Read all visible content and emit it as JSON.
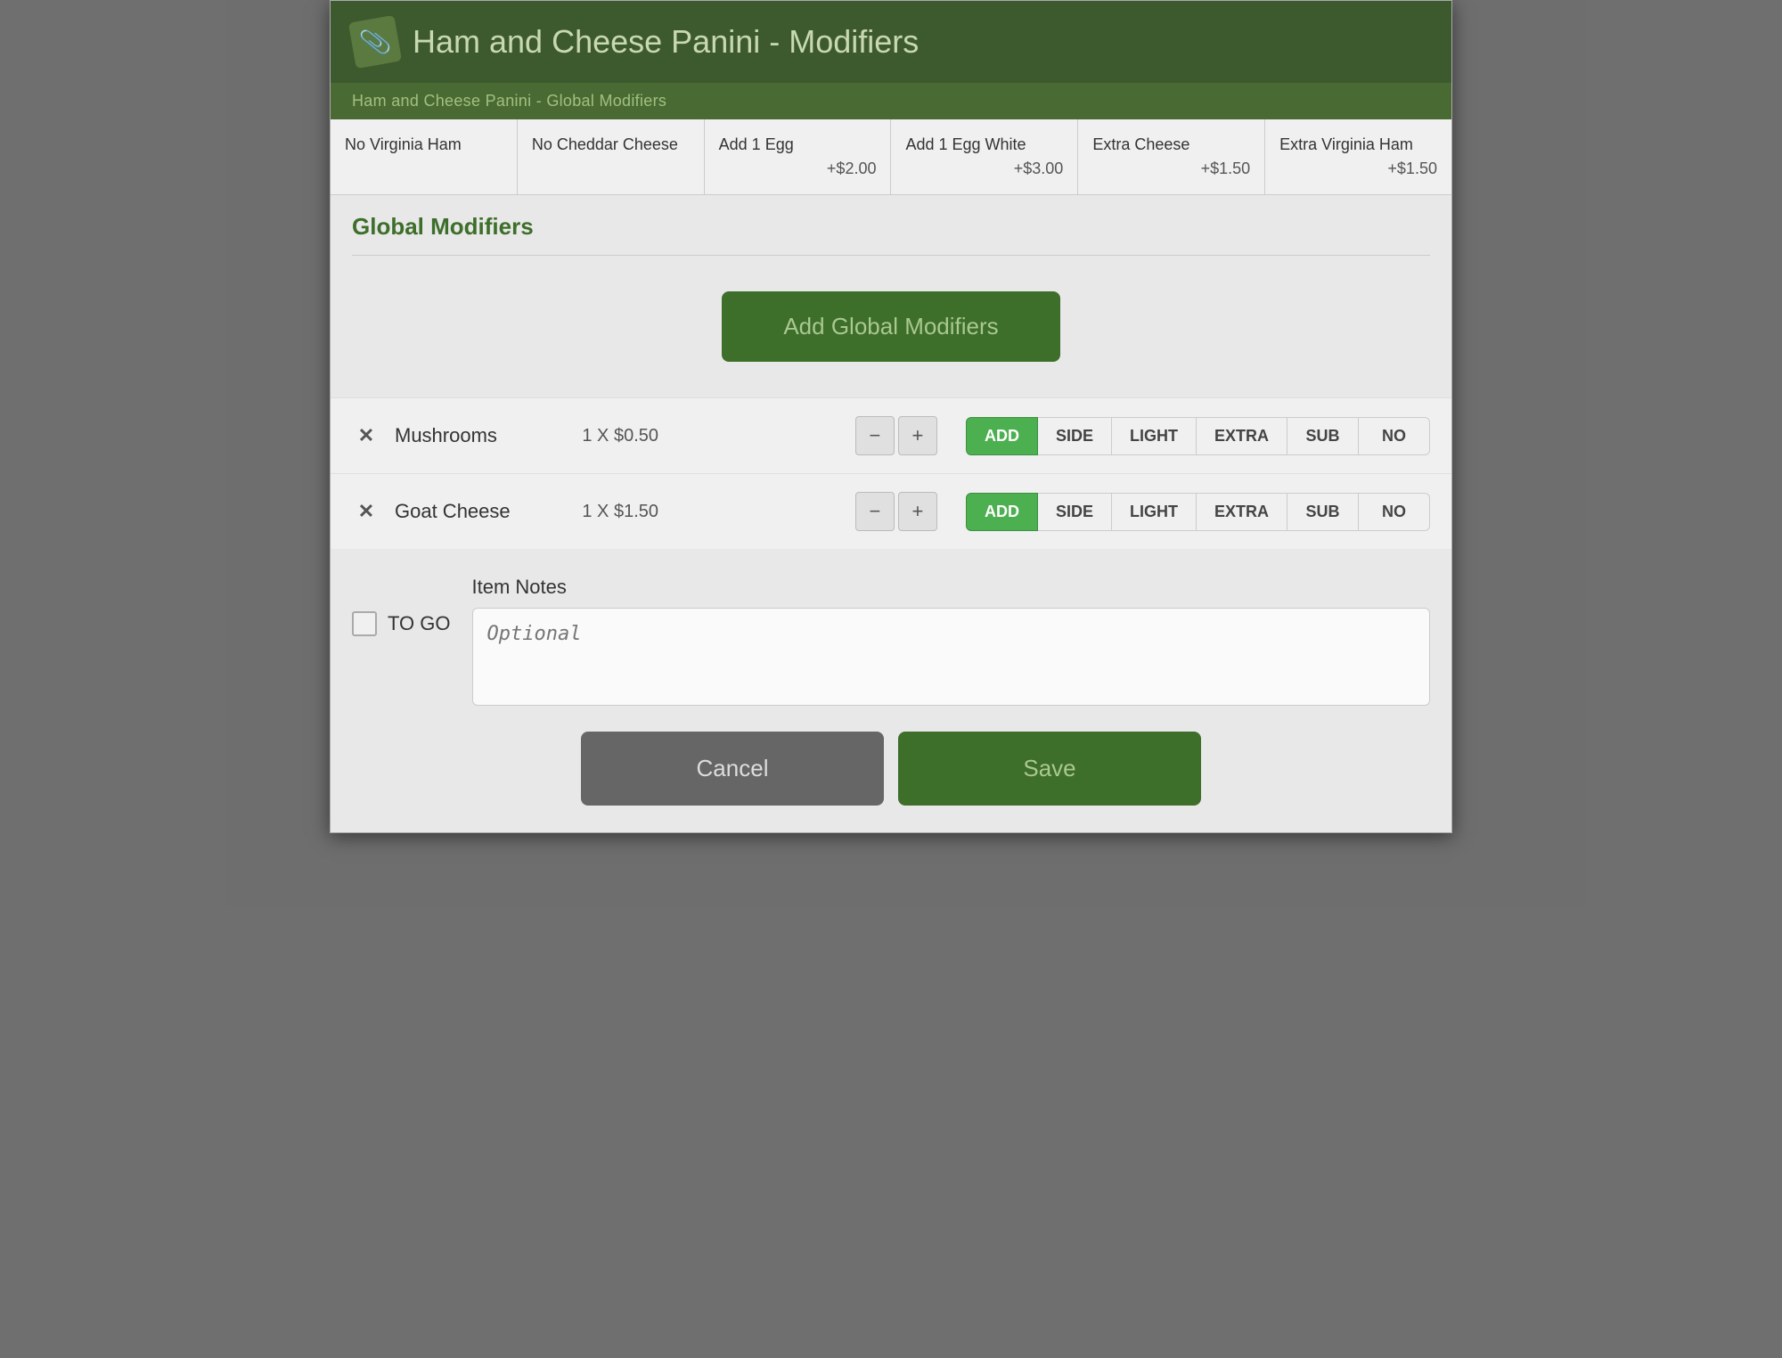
{
  "header": {
    "title": "Ham and Cheese Panini - Modifiers",
    "subtitle": "Ham and Cheese Panini - Global Modifiers",
    "icon": "📎"
  },
  "chips": [
    {
      "name": "No Virginia Ham",
      "price": ""
    },
    {
      "name": "No Cheddar Cheese",
      "price": ""
    },
    {
      "name": "Add 1 Egg",
      "price": "+$2.00"
    },
    {
      "name": "Add 1 Egg White",
      "price": "+$3.00"
    },
    {
      "name": "Extra Cheese",
      "price": "+$1.50"
    },
    {
      "name": "Extra Virginia Ham",
      "price": "+$1.50"
    }
  ],
  "global_modifiers": {
    "section_title": "Global Modifiers",
    "add_button_label": "Add Global Modifiers"
  },
  "modifier_rows": [
    {
      "name": "Mushrooms",
      "qty_label": "1 X $0.50",
      "options": [
        "ADD",
        "SIDE",
        "LIGHT",
        "EXTRA",
        "SUB",
        "NO"
      ],
      "active_option": "ADD"
    },
    {
      "name": "Goat Cheese",
      "qty_label": "1 X $1.50",
      "options": [
        "ADD",
        "SIDE",
        "LIGHT",
        "EXTRA",
        "SUB",
        "NO"
      ],
      "active_option": "ADD"
    }
  ],
  "bottom": {
    "item_notes_label": "Item Notes",
    "notes_placeholder": "Optional",
    "togo_label": "TO GO",
    "cancel_label": "Cancel",
    "save_label": "Save"
  }
}
